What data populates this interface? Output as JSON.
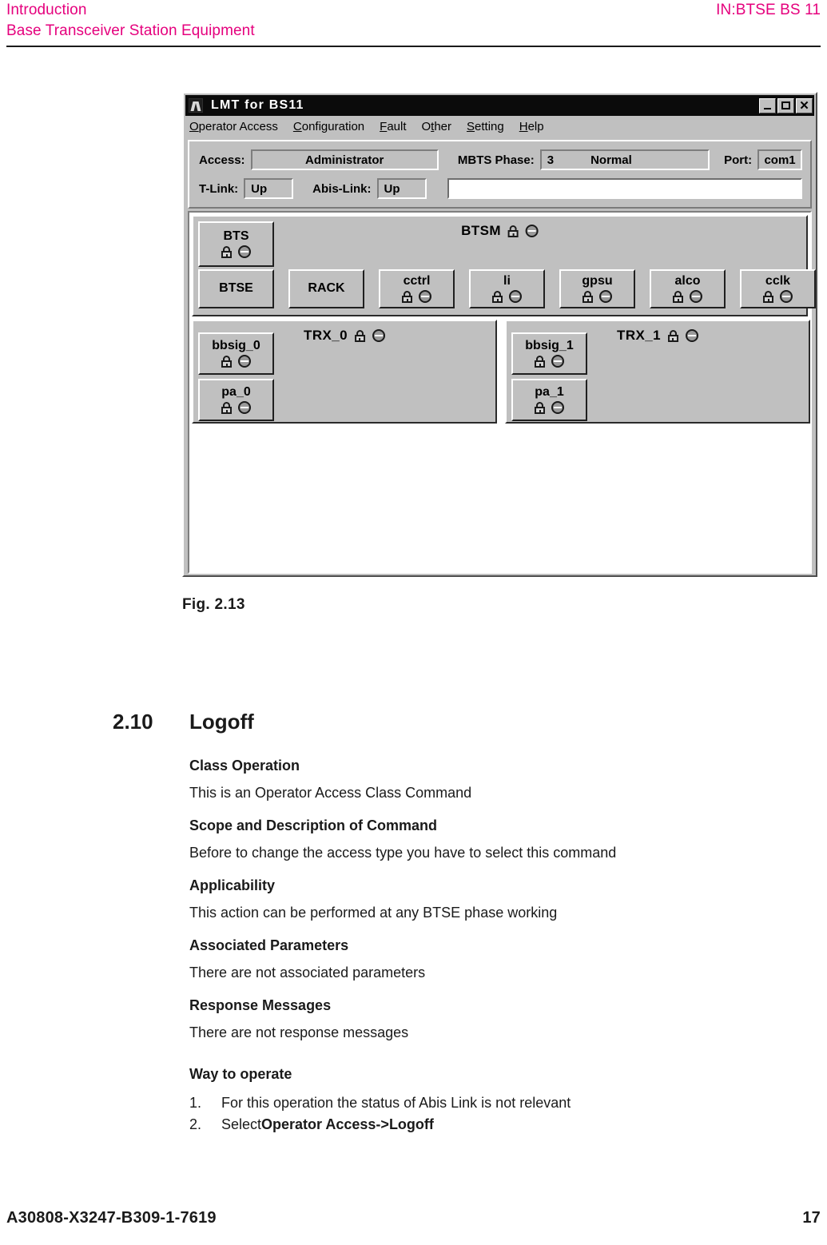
{
  "page_header": {
    "left_line1": "Introduction",
    "left_line2": "Base Transceiver Station Equipment",
    "right": "IN:BTSE BS 11"
  },
  "figure": {
    "caption": "Fig.  2.13",
    "window": {
      "title": "LMT  for  BS11",
      "window_icon": "app-icon",
      "controls": {
        "minimize": "–",
        "maximize": "□",
        "close": "×"
      },
      "menus": [
        {
          "label": "Operator Access",
          "accel": "O"
        },
        {
          "label": "Configuration",
          "accel": "C"
        },
        {
          "label": "Fault",
          "accel": "F"
        },
        {
          "label": "Other",
          "accel": "t"
        },
        {
          "label": "Setting",
          "accel": "S"
        },
        {
          "label": "Help",
          "accel": "H"
        }
      ],
      "status": {
        "access_label": "Access:",
        "access_value": "Administrator",
        "mbts_phase_label": "MBTS Phase:",
        "mbts_phase_number": "3",
        "mbts_phase_state": "Normal",
        "port_label": "Port:",
        "port_value": "com1",
        "tlink_label": "T-Link:",
        "tlink_value": "Up",
        "abislink_label": "Abis-Link:",
        "abislink_value": "Up",
        "command_input_value": ""
      },
      "tree": {
        "btsm": {
          "title": "BTSM",
          "icons": [
            "lock-icon",
            "disabled-oval-icon"
          ],
          "nodes": [
            {
              "label": "BTS",
              "icons": [
                "lock-icon",
                "disabled-oval-icon"
              ]
            },
            {
              "label": "BTSE",
              "icons": []
            },
            {
              "label": "RACK",
              "icons": []
            },
            {
              "label": "cctrl",
              "icons": [
                "lock-icon",
                "disabled-oval-icon"
              ]
            },
            {
              "label": "li",
              "icons": [
                "lock-icon",
                "disabled-oval-icon"
              ]
            },
            {
              "label": "gpsu",
              "icons": [
                "lock-icon",
                "disabled-oval-icon"
              ]
            },
            {
              "label": "alco",
              "icons": [
                "lock-icon",
                "disabled-oval-icon"
              ]
            },
            {
              "label": "cclk",
              "icons": [
                "lock-icon",
                "disabled-oval-icon"
              ]
            }
          ]
        },
        "trx": [
          {
            "title": "TRX_0",
            "icons": [
              "lock-icon",
              "disabled-oval-icon"
            ],
            "nodes": [
              {
                "label": "bbsig_0",
                "icons": [
                  "lock-icon",
                  "disabled-oval-icon"
                ]
              },
              {
                "label": "pa_0",
                "icons": [
                  "lock-icon",
                  "disabled-oval-icon"
                ]
              }
            ]
          },
          {
            "title": "TRX_1",
            "icons": [
              "lock-icon",
              "disabled-oval-icon"
            ],
            "nodes": [
              {
                "label": "bbsig_1",
                "icons": [
                  "lock-icon",
                  "disabled-oval-icon"
                ]
              },
              {
                "label": "pa_1",
                "icons": [
                  "lock-icon",
                  "disabled-oval-icon"
                ]
              }
            ]
          }
        ]
      }
    }
  },
  "section": {
    "number": "2.10",
    "title": "Logoff",
    "blocks": [
      {
        "heading": "Class Operation",
        "text": "This is an Operator Access Class Command"
      },
      {
        "heading": "Scope and Description of Command",
        "text": "Before to change the access type you have to select this command"
      },
      {
        "heading": "Applicability",
        "text": "This action can be performed at any BTSE phase working"
      },
      {
        "heading": "Associated Parameters",
        "text": "There are not associated parameters"
      },
      {
        "heading": "Response Messages",
        "text": "There are not response messages"
      }
    ],
    "way_to_operate": {
      "heading": "Way to operate",
      "steps": [
        {
          "num": "1.",
          "text": "For this operation the status of Abis Link is not relevant",
          "bold": ""
        },
        {
          "num": "2.",
          "text": "Select ",
          "bold": "Operator Access->Logoff"
        }
      ]
    }
  },
  "page_footer": {
    "document_id": "A30808-X3247-B309-1-7619",
    "page_number": "17"
  },
  "colors": {
    "header_accent": "#e5007d",
    "window_face": "#c0c0c0",
    "titlebar": "#0b0b0b",
    "text": "#1a1a1a"
  }
}
